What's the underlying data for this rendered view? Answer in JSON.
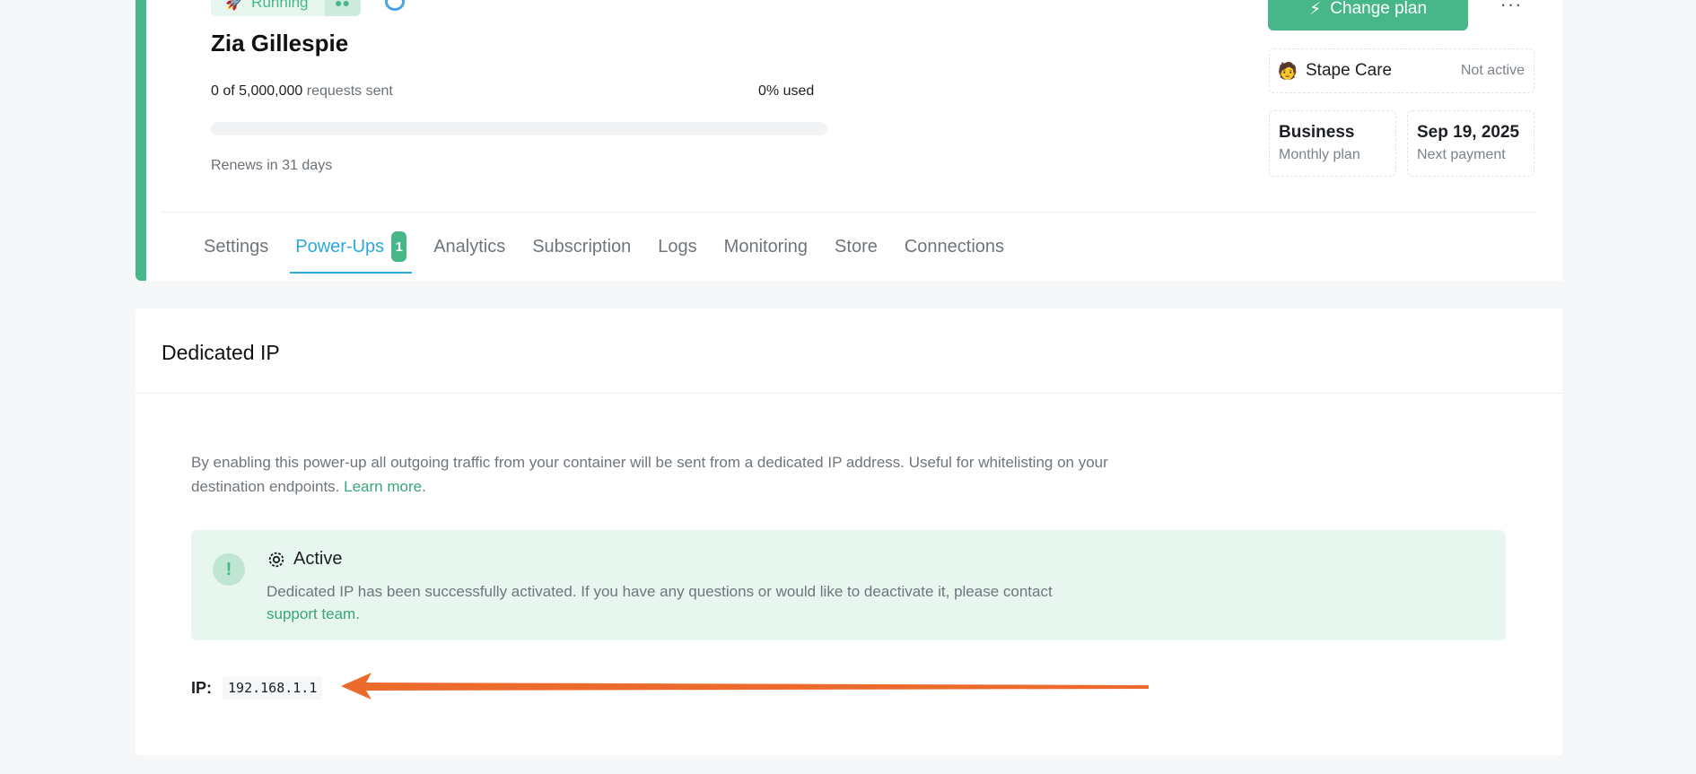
{
  "container": {
    "status_label": "Running",
    "name": "Zia Gillespie",
    "requests_count": "0 of 5,000,000",
    "requests_suffix": "requests sent",
    "usage_percent": "0% used",
    "usage_fraction": 0,
    "renews_text": "Renews in 31 days"
  },
  "plan_panel": {
    "change_plan_label": "Change plan",
    "more_label": "···",
    "care_label": "Stape Care",
    "care_status": "Not active",
    "plan_name": "Business",
    "plan_type": "Monthly plan",
    "payment_date": "Sep 19, 2025",
    "payment_label": "Next payment"
  },
  "tabs": [
    {
      "label": "Settings"
    },
    {
      "label": "Power-Ups",
      "badge": "1",
      "active": true
    },
    {
      "label": "Analytics"
    },
    {
      "label": "Subscription"
    },
    {
      "label": "Logs"
    },
    {
      "label": "Monitoring"
    },
    {
      "label": "Store"
    },
    {
      "label": "Connections"
    }
  ],
  "dedicated_ip": {
    "title": "Dedicated IP",
    "description": "By enabling this power-up all outgoing traffic from your container will be sent from a dedicated IP address. Useful for whitelisting on your destination endpoints.",
    "learn_more": "Learn more",
    "alert_title": "Active",
    "alert_text": "Dedicated IP has been successfully activated. If you have any questions or would like to deactivate it, please contact",
    "alert_link": "support team",
    "ip_label": "IP:",
    "ip_value": "192.168.1.1"
  },
  "colors": {
    "accent_green": "#47b78a",
    "tab_active_blue": "#2aa8e0",
    "annotation_arrow": "#ec6a2c"
  },
  "icons": {
    "status": "rocket-icon",
    "globe": "globe-icon",
    "change_plan": "lightning-icon",
    "care": "person-icon",
    "alert": "exclamation-icon",
    "alert_title": "gear-icon"
  }
}
